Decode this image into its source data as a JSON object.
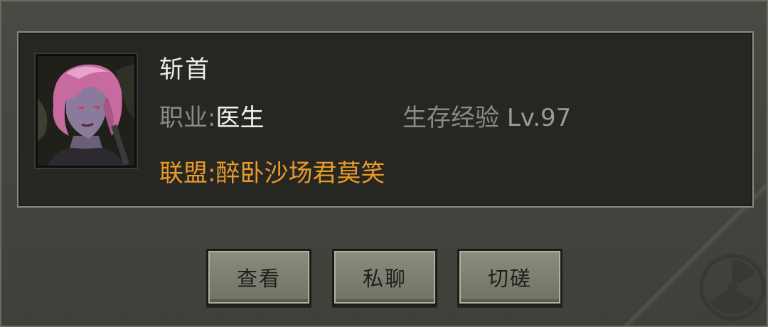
{
  "player": {
    "name": "斩首",
    "job_label": "职业:",
    "job_value": "医生",
    "exp_label": "生存经验",
    "level": "Lv.97",
    "alliance_label": "联盟:",
    "alliance_name": "醉卧沙场君莫笑"
  },
  "buttons": {
    "view": "查看",
    "chat": "私聊",
    "duel": "切磋"
  },
  "colors": {
    "alliance": "#e89a2a",
    "panel_bg": "#262622",
    "button_bg": "#7e7e71"
  },
  "icons": {
    "avatar": "player-portrait",
    "decoration": "radiation-icon"
  }
}
